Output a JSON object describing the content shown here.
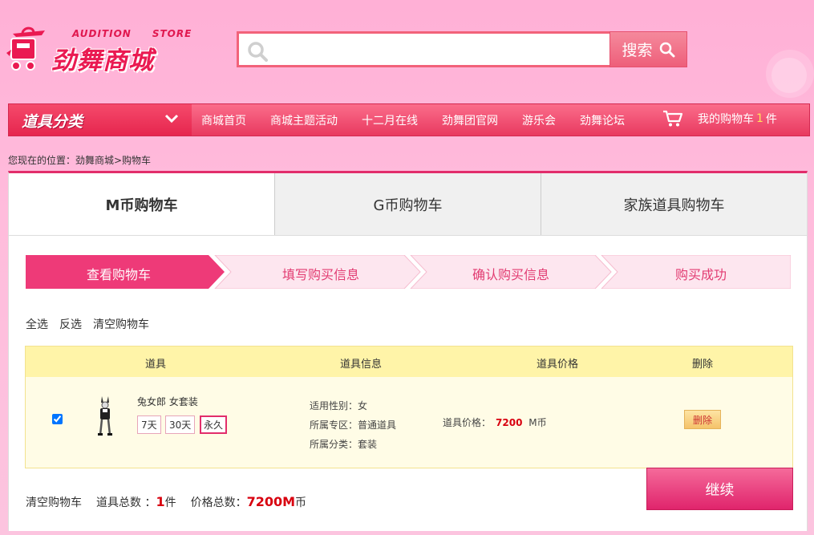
{
  "colors": {
    "accent": "#e22d6b",
    "nav": "#f0486b",
    "price": "#d8000f",
    "background": "#ffb6da"
  },
  "logo": {
    "en_left": "AUDITION",
    "en_right": "STORE",
    "cn": "劲舞商城",
    "icon": "shopping-bag-icon"
  },
  "search": {
    "placeholder": "",
    "button": "搜索"
  },
  "nav": {
    "category_label": "道具分类",
    "links": [
      "商城首页",
      "商城主题活动",
      "十二月在线",
      "劲舞团官网",
      "游乐会",
      "劲舞论坛"
    ],
    "cart_prefix": "我的购物车",
    "cart_count": "1",
    "cart_suffix": "件"
  },
  "breadcrumb": "您现在的位置：劲舞商城>购物车",
  "cart_tabs": [
    "M币购物车",
    "G币购物车",
    "家族道具购物车"
  ],
  "steps": [
    "查看购物车",
    "填写购买信息",
    "确认购买信息",
    "购买成功"
  ],
  "actions": [
    "全选",
    "反选",
    "清空购物车"
  ],
  "table": {
    "headers": [
      "道具",
      "道具信息",
      "道具价格",
      "删除"
    ],
    "rows": [
      {
        "checked": true,
        "name": "兔女郎 女套装",
        "durations": [
          "7天",
          "30天",
          "永久"
        ],
        "selected_duration": "永久",
        "info": [
          "适用性别：女",
          "所属专区：普通道具",
          "所属分类：套装"
        ],
        "price_label": "道具价格：",
        "price_value": "7200",
        "price_unit": "M币",
        "delete_label": "删除"
      }
    ]
  },
  "footer": {
    "clear_label": "清空购物车",
    "count_label": "道具总数 ：",
    "count_value": "1",
    "count_unit": "件",
    "total_label": "价格总数：",
    "total_value": "7200M",
    "total_unit": "币"
  },
  "continue_button": "继续"
}
